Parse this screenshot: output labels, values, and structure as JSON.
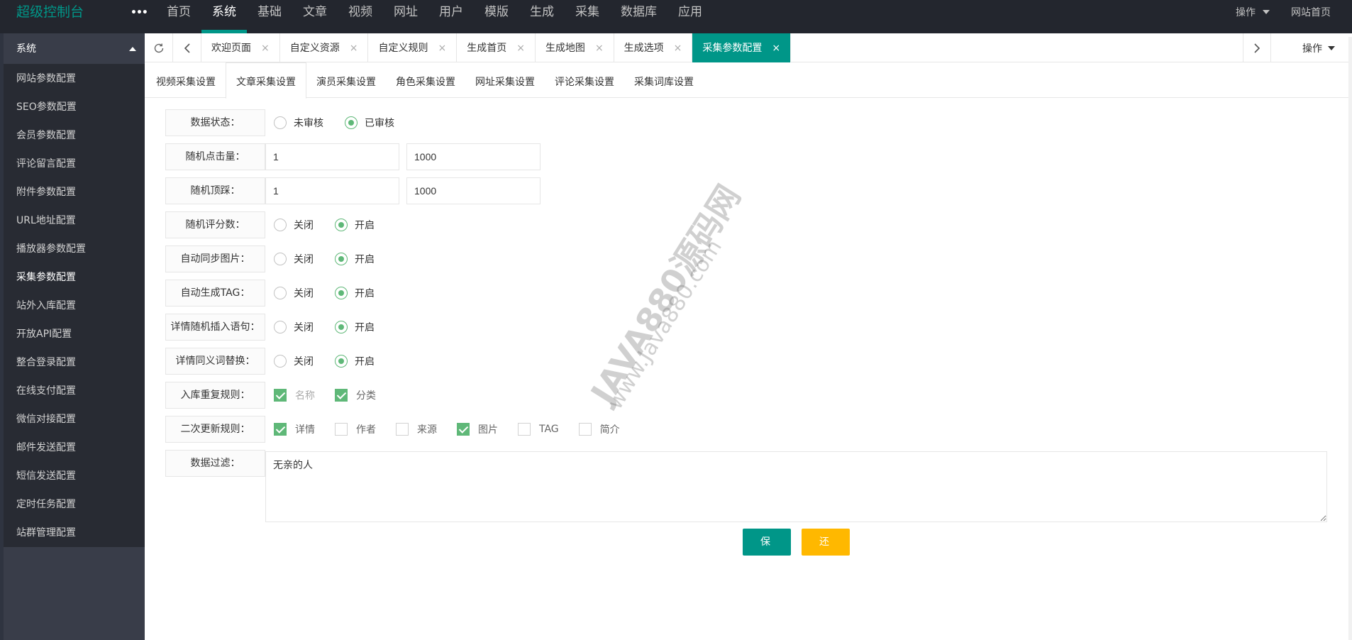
{
  "header": {
    "logo": "超级控制台",
    "more_glyph": "•••",
    "nav": [
      "首页",
      "系统",
      "基础",
      "文章",
      "视频",
      "网址",
      "用户",
      "模版",
      "生成",
      "采集",
      "数据库",
      "应用"
    ],
    "active_nav": "系统",
    "operate": "操作",
    "site_home": "网站首页"
  },
  "sidebar": {
    "group": "系统",
    "items": [
      "网站参数配置",
      "SEO参数配置",
      "会员参数配置",
      "评论留言配置",
      "附件参数配置",
      "URL地址配置",
      "播放器参数配置",
      "采集参数配置",
      "站外入库配置",
      "开放API配置",
      "整合登录配置",
      "在线支付配置",
      "微信对接配置",
      "邮件发送配置",
      "短信发送配置",
      "定时任务配置",
      "站群管理配置"
    ],
    "active_item": "采集参数配置"
  },
  "tabs": {
    "items": [
      "欢迎页面",
      "自定义资源",
      "自定义规则",
      "生成首页",
      "生成地图",
      "生成选项",
      "采集参数配置"
    ],
    "active": "采集参数配置",
    "close_glyph": "×",
    "operate": "操作"
  },
  "subtabs": {
    "items": [
      "视频采集设置",
      "文章采集设置",
      "演员采集设置",
      "角色采集设置",
      "网址采集设置",
      "评论采集设置",
      "采集词库设置"
    ],
    "active": "文章采集设置"
  },
  "form": {
    "status": {
      "label": "数据状态：",
      "options": [
        "未审核",
        "已审核"
      ],
      "selected": "已审核"
    },
    "hits": {
      "label": "随机点击量：",
      "min": "1",
      "max": "1000"
    },
    "updown": {
      "label": "随机顶踩：",
      "min": "1",
      "max": "1000"
    },
    "score": {
      "label": "随机评分数：",
      "options": [
        "关闭",
        "开启"
      ],
      "selected": "开启"
    },
    "sync_pic": {
      "label": "自动同步图片：",
      "options": [
        "关闭",
        "开启"
      ],
      "selected": "开启"
    },
    "auto_tag": {
      "label": "自动生成TAG：",
      "options": [
        "关闭",
        "开启"
      ],
      "selected": "开启"
    },
    "insert_words": {
      "label": "详情随机插入语句：",
      "options": [
        "关闭",
        "开启"
      ],
      "selected": "开启"
    },
    "synonym": {
      "label": "详情同义词替换：",
      "options": [
        "关闭",
        "开启"
      ],
      "selected": "开启"
    },
    "dup_rule": {
      "label": "入库重复规则：",
      "options": [
        "名称",
        "分类"
      ],
      "checked": [
        "名称",
        "分类"
      ]
    },
    "update_rule": {
      "label": "二次更新规则：",
      "options": [
        "详情",
        "作者",
        "来源",
        "图片",
        "TAG",
        "简介"
      ],
      "checked": [
        "详情",
        "图片"
      ]
    },
    "filter": {
      "label": "数据过滤：",
      "value": "无亲的人"
    }
  },
  "buttons": {
    "save": "保存",
    "reset": "还原"
  },
  "watermark": {
    "line1": "JAVA880源码网",
    "line2": "www.Java880.com"
  },
  "colors": {
    "header_bg": "#23262e",
    "sidebar_bg": "#393d49",
    "accent": "#009688",
    "radio_on": "#5fb878",
    "warn": "#ffb800"
  }
}
